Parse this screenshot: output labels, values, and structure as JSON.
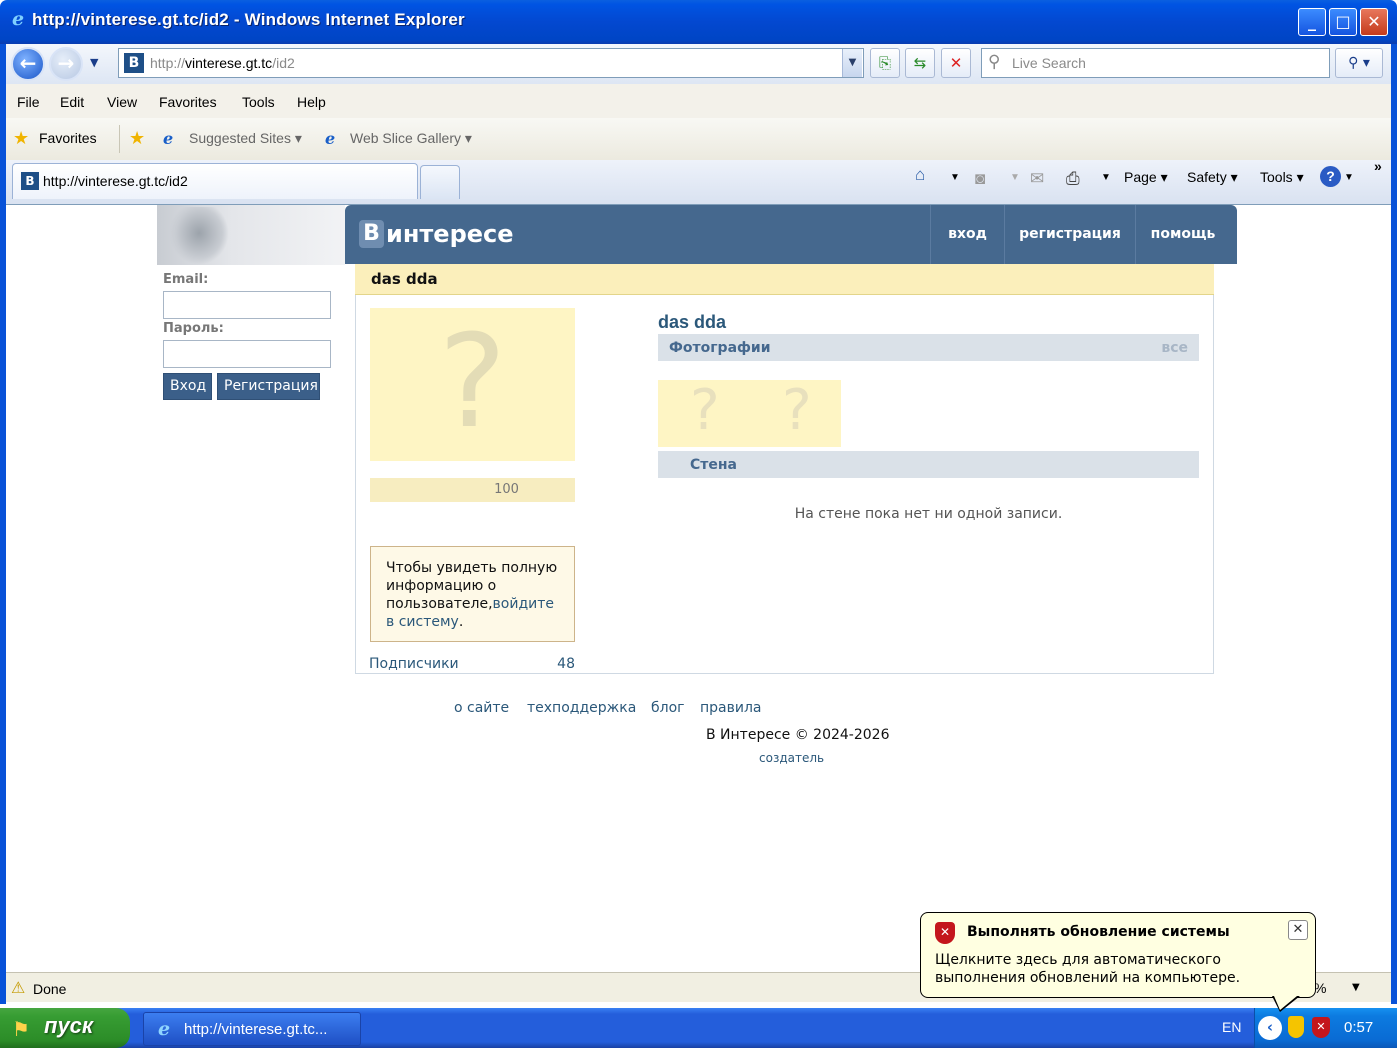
{
  "window": {
    "title": "http://vinterese.gt.tc/id2 - Windows Internet Explorer",
    "minimize_glyph": "_",
    "maximize_glyph": "□",
    "close_glyph": "✕"
  },
  "addressbar": {
    "url_prefix": "http://",
    "url_host": "vinterese.gt.tc",
    "url_path": "/id2",
    "favicon_letter": "B",
    "search_placeholder": "Live Search"
  },
  "menu": [
    "File",
    "Edit",
    "View",
    "Favorites",
    "Tools",
    "Help"
  ],
  "favorites_bar": {
    "favorites_label": "Favorites",
    "suggested_sites": "Suggested Sites",
    "web_slice_gallery": "Web Slice Gallery"
  },
  "tab": {
    "label": "http://vinterese.gt.tc/id2",
    "favicon_letter": "B"
  },
  "command_bar": {
    "page": "Page",
    "safety": "Safety",
    "tools": "Tools",
    "overflow": "»"
  },
  "site": {
    "logo_letter": "В",
    "logo_text": "интересе",
    "nav": [
      "вход",
      "регистрация",
      "помощь"
    ],
    "login": {
      "email_label": "Email:",
      "password_label": "Пароль:",
      "login_button": "Вход",
      "register_button": "Регистрация"
    },
    "profile": {
      "header_name": "das dda",
      "name": "das dda",
      "avatar_placeholder": "?",
      "rating": "100",
      "info_text": "Чтобы увидеть полную информацию о пользователе,",
      "info_link": "войдите в систему",
      "info_end": ".",
      "subscribers_label": "Подписчики",
      "subscribers_count": "48",
      "photos_label": "Фотографии",
      "photos_all": "все",
      "photo_placeholders": [
        "?",
        "?"
      ],
      "wall_label": "Стена",
      "wall_empty": "На стене пока нет ни одной записи."
    },
    "footer": {
      "links": [
        "о сайте",
        "техподдержка",
        "блог",
        "правила"
      ],
      "copyright": "В Интересе © 2024-2026",
      "creator": "создатель"
    }
  },
  "status": {
    "text": "Done",
    "zoom_fragment": "%"
  },
  "taskbar": {
    "start_label": "пуск",
    "task_label": "http://vinterese.gt.tc...",
    "language": "EN",
    "clock": "0:57"
  },
  "balloon": {
    "title": "Выполнять обновление системы",
    "body": "Щелкните здесь для автоматического выполнения обновлений на компьютере."
  }
}
